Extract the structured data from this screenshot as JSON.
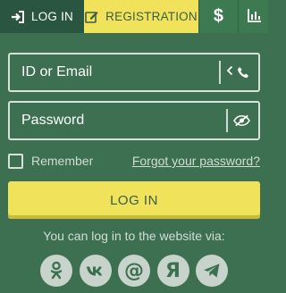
{
  "tabs": {
    "login": "LOG IN",
    "registration": "REGISTRATION",
    "deposit_symbol": "$"
  },
  "form": {
    "id_placeholder": "ID or Email",
    "password_placeholder": "Password",
    "remember_label": "Remember",
    "forgot_link": "Forgot your password?",
    "login_button": "LOG IN"
  },
  "social": {
    "caption": "You can log in to the website via:",
    "at_symbol": "@",
    "yandex_symbol": "Я",
    "providers": [
      "odnoklassniki-icon",
      "vk-icon",
      "mail-icon",
      "yandex-icon",
      "telegram-icon"
    ]
  },
  "colors": {
    "background": "#3c7050",
    "accent_yellow": "#f0e25a",
    "tab_dark": "#2a5540",
    "text_muted": "#d3ddd6"
  }
}
